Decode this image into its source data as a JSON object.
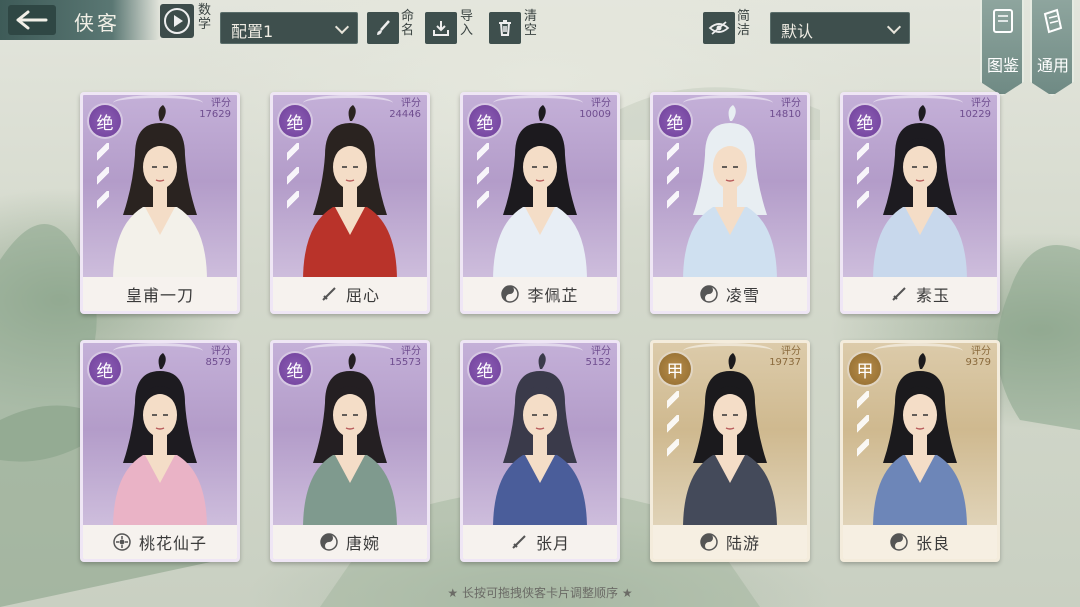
{
  "header": {
    "title": "侠客",
    "play_label": "数学",
    "config_select": "配置1",
    "rename_label": "命名",
    "import_label": "导入",
    "clear_label": "清空",
    "simple_label": "简洁",
    "sort_select": "默认",
    "atlas_label": "图鉴",
    "general_label": "通用"
  },
  "score_label": "评分",
  "cards": [
    {
      "name": "皇甫一刀",
      "grade": "绝",
      "score": "17629",
      "rarity": "rare",
      "icon": "none",
      "blades": 3
    },
    {
      "name": "屈心",
      "grade": "绝",
      "score": "24446",
      "rarity": "rare",
      "icon": "sword-icon",
      "blades": 3
    },
    {
      "name": "李佩芷",
      "grade": "绝",
      "score": "10009",
      "rarity": "rare",
      "icon": "taiji-icon",
      "blades": 3
    },
    {
      "name": "凌雪",
      "grade": "绝",
      "score": "14810",
      "rarity": "rare",
      "icon": "taiji-icon",
      "blades": 3
    },
    {
      "name": "素玉",
      "grade": "绝",
      "score": "10229",
      "rarity": "rare",
      "icon": "sword-icon",
      "blades": 3
    },
    {
      "name": "桃花仙子",
      "grade": "绝",
      "score": "8579",
      "rarity": "rare",
      "icon": "flower-icon",
      "blades": 0
    },
    {
      "name": "唐婉",
      "grade": "绝",
      "score": "15573",
      "rarity": "rare",
      "icon": "taiji-icon",
      "blades": 0
    },
    {
      "name": "张月",
      "grade": "绝",
      "score": "5152",
      "rarity": "rare",
      "icon": "sword-icon",
      "blades": 0
    },
    {
      "name": "陆游",
      "grade": "甲",
      "score": "19737",
      "rarity": "common",
      "icon": "taiji-icon",
      "blades": 3
    },
    {
      "name": "张良",
      "grade": "甲",
      "score": "9379",
      "rarity": "common",
      "icon": "taiji-icon",
      "blades": 3
    }
  ],
  "hint": "长按可拖拽侠客卡片调整顺序"
}
